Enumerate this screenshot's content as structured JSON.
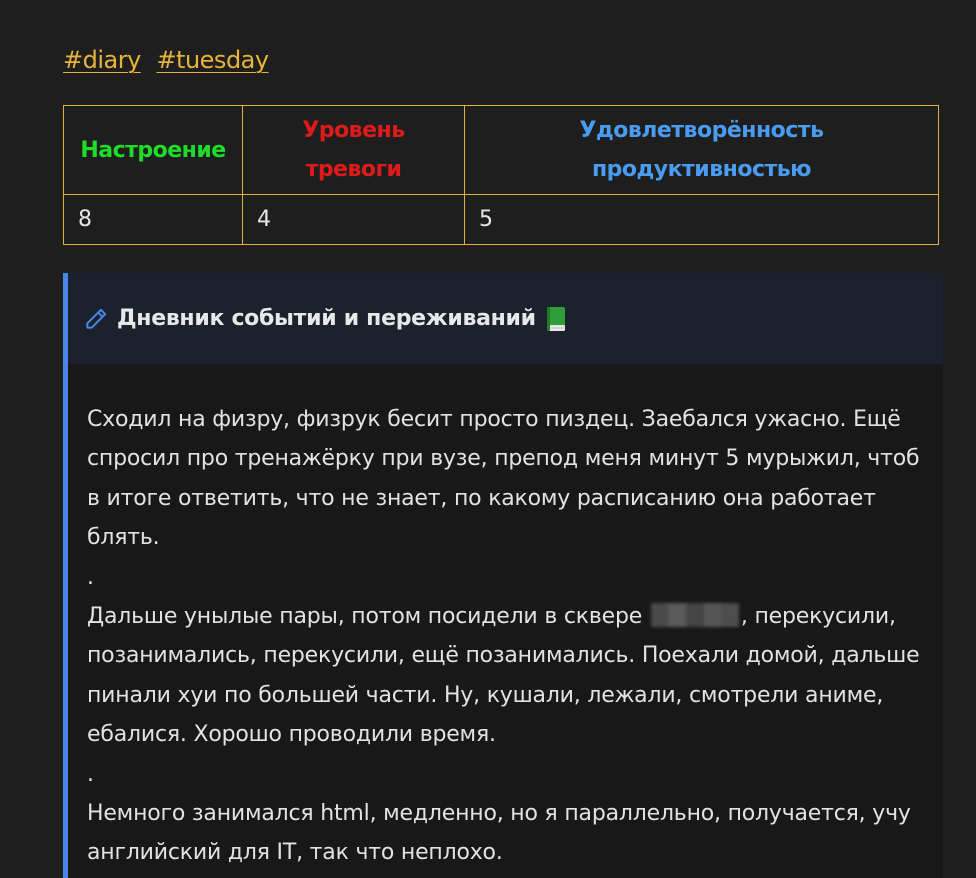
{
  "tags": [
    "#diary",
    "#tuesday"
  ],
  "table": {
    "headers": [
      "Настроение",
      "Уровень тревоги",
      "Удовлетворённость продуктивностью"
    ],
    "header_colors": [
      "#1fdc28",
      "#e01a1a",
      "#4a9cf0"
    ],
    "values": [
      "8",
      "4",
      "5"
    ]
  },
  "callout": {
    "icon": "pencil-icon",
    "title": "Дневник событий и переживаний",
    "title_emoji": "green-book-icon",
    "accent_color": "#4a86e8",
    "paragraphs": {
      "p1": "Сходил на физру, физрук бесит просто пиздец. Заебался ужасно. Ещё спросил про тренажёрку при вузе, препод меня минут 5 мурыжил, чтоб в итоге ответить, что не знает, по какому расписанию она работает блять.",
      "sep1": ".",
      "p2_before": "Дальше унылые пары, потом посидели в сквере",
      "p2_after": ", перекусили, позанимались, перекусили, ещё позанимались. Поехали домой, дальше пинали хуи по большей части. Ну, кушали, лежали, смотрели аниме, ебалися. Хорошо проводили время.",
      "sep2": ".",
      "p3": "Немного занимался html, медленно, но я параллельно, получается, учу английский для IT, так что неплохо."
    }
  }
}
